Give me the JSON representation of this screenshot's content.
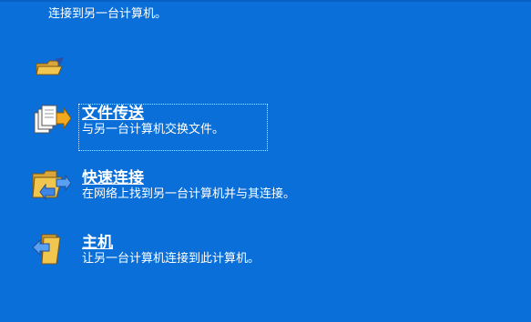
{
  "intro": {
    "text": "连接到另一台计算机。",
    "icon": "folder-arrow-icon"
  },
  "options": [
    {
      "title": "文件传送",
      "description": "与另一台计算机交换文件。",
      "icon": "file-transfer-icon"
    },
    {
      "title": "快速连接",
      "description": "在网络上找到另一台计算机并与其连接。",
      "icon": "quick-connect-icon"
    },
    {
      "title": "主机",
      "description": "让另一台计算机连接到此计算机。",
      "icon": "host-icon"
    }
  ],
  "colors": {
    "background": "#0a6fd8",
    "text": "#ffffff"
  }
}
